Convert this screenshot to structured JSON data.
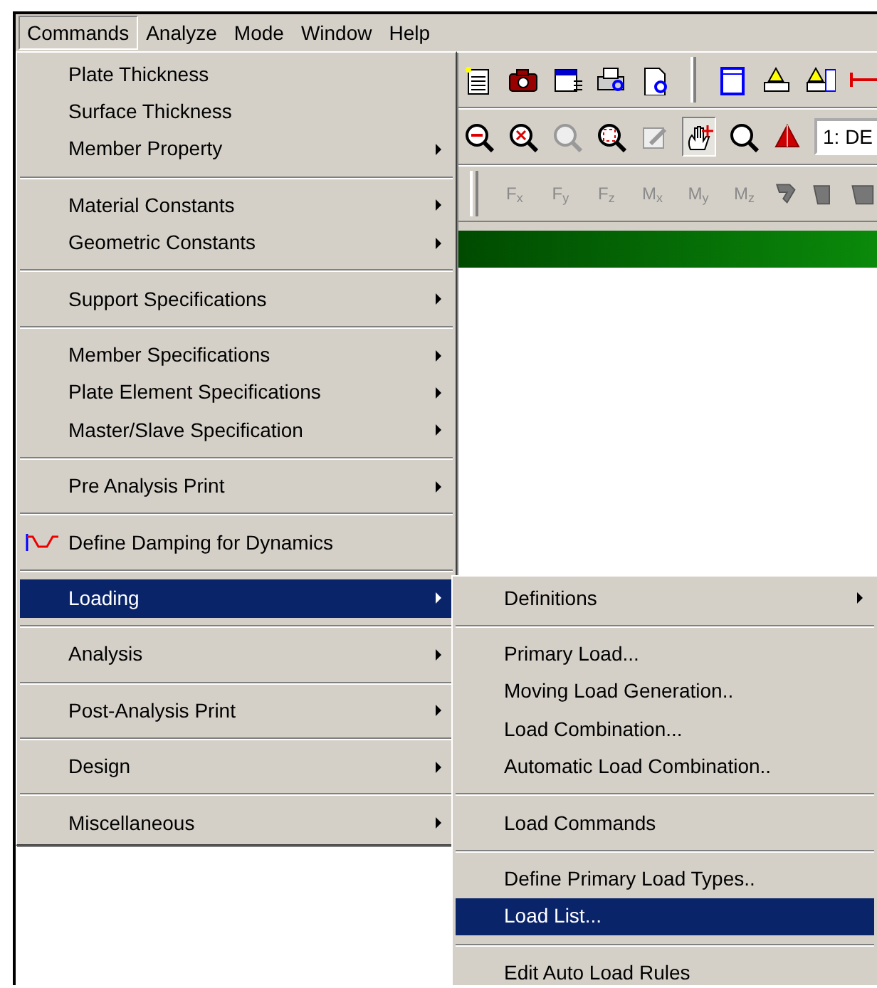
{
  "menubar": [
    {
      "label": "Commands",
      "selected": true
    },
    {
      "label": "Analyze",
      "selected": false
    },
    {
      "label": "Mode",
      "selected": false
    },
    {
      "label": "Window",
      "selected": false
    },
    {
      "label": "Help",
      "selected": false
    }
  ],
  "toolbar": {
    "view_field": "1: DE",
    "force_buttons": [
      {
        "label": "F$_{x}$",
        "disabled": true
      },
      {
        "label": "F$_{y}$",
        "disabled": true
      },
      {
        "label": "F$_{z}$",
        "disabled": true
      },
      {
        "label": "M$_{x}$",
        "disabled": true
      },
      {
        "label": "M$_{y}$",
        "disabled": true
      },
      {
        "label": "M$_{z}$",
        "disabled": true
      }
    ]
  },
  "commands_menu": [
    {
      "kind": "item",
      "label": "Plate Thickness",
      "submenu": false,
      "selected": false
    },
    {
      "kind": "item",
      "label": "Surface Thickness",
      "submenu": false,
      "selected": false
    },
    {
      "kind": "item",
      "label": "Member Property",
      "submenu": true,
      "selected": false
    },
    {
      "kind": "separator"
    },
    {
      "kind": "item",
      "label": "Material Constants",
      "submenu": true,
      "selected": false
    },
    {
      "kind": "item",
      "label": "Geometric Constants",
      "submenu": true,
      "selected": false
    },
    {
      "kind": "separator"
    },
    {
      "kind": "item",
      "label": "Support Specifications",
      "submenu": true,
      "selected": false
    },
    {
      "kind": "separator"
    },
    {
      "kind": "item",
      "label": "Member Specifications",
      "submenu": true,
      "selected": false
    },
    {
      "kind": "item",
      "label": "Plate Element Specifications",
      "submenu": true,
      "selected": false
    },
    {
      "kind": "item",
      "label": "Master/Slave Specification",
      "submenu": true,
      "selected": false
    },
    {
      "kind": "separator"
    },
    {
      "kind": "item",
      "label": "Pre Analysis Print",
      "submenu": true,
      "selected": false
    },
    {
      "kind": "separator"
    },
    {
      "kind": "icon_item",
      "label": "Define Damping for Dynamics",
      "submenu": false,
      "selected": false
    },
    {
      "kind": "separator"
    },
    {
      "kind": "item",
      "label": "Loading",
      "submenu": true,
      "selected": true
    },
    {
      "kind": "separator"
    },
    {
      "kind": "item",
      "label": "Analysis",
      "submenu": true,
      "selected": false
    },
    {
      "kind": "separator"
    },
    {
      "kind": "item",
      "label": "Post-Analysis Print",
      "submenu": true,
      "selected": false
    },
    {
      "kind": "separator"
    },
    {
      "kind": "item",
      "label": "Design",
      "submenu": true,
      "selected": false
    },
    {
      "kind": "separator"
    },
    {
      "kind": "item",
      "label": "Miscellaneous",
      "submenu": true,
      "selected": false
    }
  ],
  "loading_submenu": [
    {
      "kind": "item",
      "label": "Definitions",
      "submenu": true,
      "selected": false
    },
    {
      "kind": "separator"
    },
    {
      "kind": "item",
      "label": "Primary Load...",
      "submenu": false,
      "selected": false
    },
    {
      "kind": "item",
      "label": "Moving Load Generation..",
      "submenu": false,
      "selected": false
    },
    {
      "kind": "item",
      "label": "Load Combination...",
      "submenu": false,
      "selected": false
    },
    {
      "kind": "item",
      "label": "Automatic Load Combination..",
      "submenu": false,
      "selected": false
    },
    {
      "kind": "separator"
    },
    {
      "kind": "item",
      "label": "Load Commands",
      "submenu": false,
      "selected": false
    },
    {
      "kind": "separator"
    },
    {
      "kind": "item",
      "label": "Define Primary Load Types..",
      "submenu": false,
      "selected": false
    },
    {
      "kind": "item",
      "label": "Load List...",
      "submenu": false,
      "selected": true
    },
    {
      "kind": "separator"
    },
    {
      "kind": "item",
      "label": "Edit Auto Load Rules",
      "submenu": false,
      "selected": false
    }
  ]
}
